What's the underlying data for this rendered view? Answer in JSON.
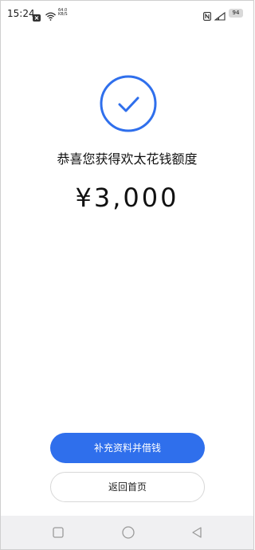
{
  "status_bar": {
    "time": "15:24",
    "network_speed_value": "64.0",
    "network_speed_unit": "KB/S",
    "battery_level": "94"
  },
  "main": {
    "title": "恭喜您获得欢太花钱额度",
    "amount": "¥3,000"
  },
  "buttons": {
    "primary_label": "补充资料并借钱",
    "secondary_label": "返回首页"
  },
  "colors": {
    "accent": "#2f6fec",
    "nav_bar_background": "#f0f0f2"
  },
  "icons": {
    "success": "check-circle-icon",
    "nav_recents": "square-icon",
    "nav_home": "circle-icon",
    "nav_back": "triangle-back-icon"
  }
}
